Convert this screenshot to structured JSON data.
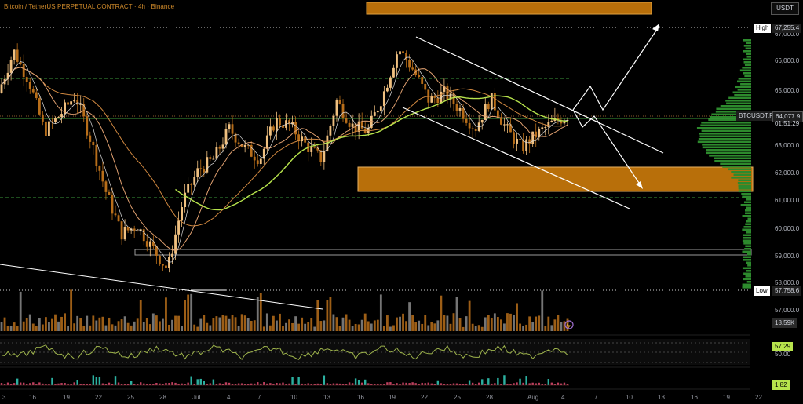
{
  "header": {
    "title": "Bitcoin / TetherUS PERPETUAL CONTRACT · 4h · Binance",
    "currency": "USDT"
  },
  "price_axis": {
    "ticks": [
      "67,000.0",
      "66,000.0",
      "65,000.0",
      "63,000.0",
      "62,000.0",
      "61,000.0",
      "60,000.0",
      "59,000.0",
      "58,000.0",
      "57,000.0"
    ],
    "high_label": "High",
    "high_value": "67,255.4",
    "low_label": "Low",
    "low_value": "57,758.6",
    "symbol_label": "BTCUSDT.P",
    "last_price": "64,077.9",
    "countdown": "01:51:29"
  },
  "time_axis": {
    "ticks": [
      "3",
      "16",
      "19",
      "22",
      "25",
      "28",
      "Jul",
      "4",
      "7",
      "10",
      "13",
      "16",
      "19",
      "22",
      "25",
      "28",
      "Aug",
      "4",
      "7",
      "10",
      "13",
      "16",
      "19",
      "22"
    ]
  },
  "indicators": {
    "volume_value": "18.59K",
    "rsi_value": "57.29",
    "rsi_level_mid": "50.00",
    "osc_value": "1.82"
  },
  "colors": {
    "up_candle": "#f0c080",
    "down_candle": "#b86e1a",
    "zone_fill": "#b86f0a",
    "ma_green": "#b7e34c",
    "profile_green": "#2d8a2d",
    "rsi_line": "#9fb54c"
  },
  "chart_data": {
    "type": "candlestick",
    "symbol": "BTCUSDT.P",
    "timeframe": "4h",
    "exchange": "Binance",
    "ylim": [
      57600,
      67600
    ],
    "x_ticks": [
      "3",
      "16",
      "19",
      "22",
      "25",
      "28",
      "Jul",
      "4",
      "7",
      "10",
      "13",
      "16",
      "19",
      "22",
      "25",
      "28",
      "Aug",
      "4",
      "7",
      "10",
      "13",
      "16",
      "19",
      "22"
    ],
    "close_path": [
      [
        0,
        64900
      ],
      [
        2,
        66400
      ],
      [
        4,
        65300
      ],
      [
        6,
        63500
      ],
      [
        8,
        64100
      ],
      [
        10,
        64800
      ],
      [
        12,
        63200
      ],
      [
        14,
        61300
      ],
      [
        16,
        59800
      ],
      [
        18,
        60100
      ],
      [
        20,
        59300
      ],
      [
        22,
        58500
      ],
      [
        24,
        61000
      ],
      [
        26,
        62100
      ],
      [
        28,
        62500
      ],
      [
        30,
        63600
      ],
      [
        32,
        62900
      ],
      [
        34,
        62500
      ],
      [
        36,
        63900
      ],
      [
        38,
        63700
      ],
      [
        40,
        63000
      ],
      [
        42,
        62500
      ],
      [
        44,
        64600
      ],
      [
        46,
        63700
      ],
      [
        48,
        63500
      ],
      [
        50,
        64800
      ],
      [
        52,
        66500
      ],
      [
        54,
        65700
      ],
      [
        56,
        64600
      ],
      [
        58,
        64900
      ],
      [
        60,
        64300
      ],
      [
        62,
        63600
      ],
      [
        64,
        64700
      ],
      [
        66,
        63600
      ],
      [
        68,
        62900
      ],
      [
        70,
        63400
      ],
      [
        72,
        63800
      ],
      [
        74,
        64077.9
      ]
    ],
    "zones": [
      {
        "from": 61250,
        "to": 62100
      },
      {
        "from": 59040,
        "to": 59140
      }
    ],
    "levels": [
      67255.4,
      57758.6,
      65400,
      63930,
      61100
    ],
    "projections": [
      "breakout up toward 67,255.4",
      "breakdown toward 61,700"
    ],
    "last_price": 64077.9,
    "high": 67255.4,
    "low": 57758.6
  }
}
